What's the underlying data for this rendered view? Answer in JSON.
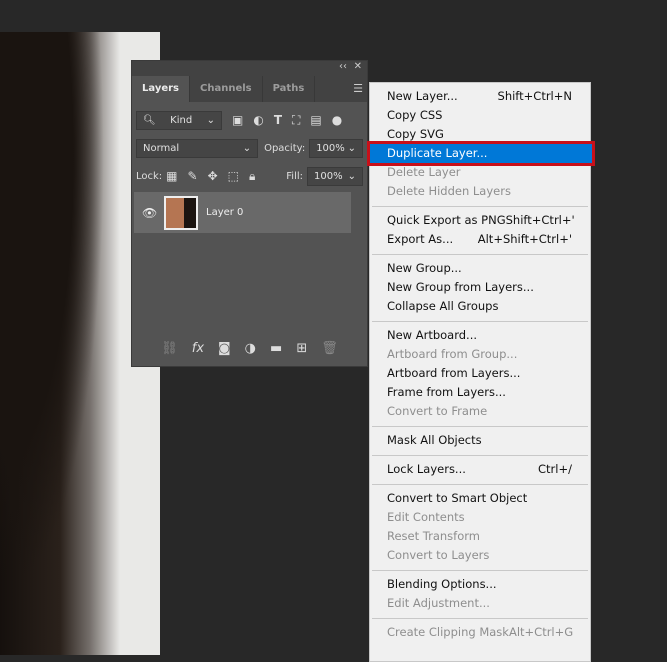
{
  "panel": {
    "tabs": [
      "Layers",
      "Channels",
      "Paths"
    ],
    "filter": "Kind",
    "blend_mode": "Normal",
    "opacity_label": "Opacity:",
    "opacity": "100%",
    "lock_label": "Lock:",
    "fill_label": "Fill:",
    "fill": "100%",
    "layers": [
      {
        "name": "Layer 0",
        "visible": true
      }
    ],
    "collapse": "‹‹",
    "close": "✕"
  },
  "menu": {
    "groups": [
      [
        {
          "label": "New Layer...",
          "shortcut": "Shift+Ctrl+N"
        },
        {
          "label": "Copy CSS"
        },
        {
          "label": "Copy SVG"
        },
        {
          "label": "Duplicate Layer...",
          "selected": true
        },
        {
          "label": "Delete Layer",
          "disabled": true
        },
        {
          "label": "Delete Hidden Layers",
          "disabled": true
        }
      ],
      [
        {
          "label": "Quick Export as PNG",
          "shortcut": "Shift+Ctrl+'"
        },
        {
          "label": "Export As...",
          "shortcut": "Alt+Shift+Ctrl+'"
        }
      ],
      [
        {
          "label": "New Group..."
        },
        {
          "label": "New Group from Layers..."
        },
        {
          "label": "Collapse All Groups"
        }
      ],
      [
        {
          "label": "New Artboard..."
        },
        {
          "label": "Artboard from Group...",
          "disabled": true
        },
        {
          "label": "Artboard from Layers..."
        },
        {
          "label": "Frame from Layers..."
        },
        {
          "label": "Convert to Frame",
          "disabled": true
        }
      ],
      [
        {
          "label": "Mask All Objects"
        }
      ],
      [
        {
          "label": "Lock Layers...",
          "shortcut": "Ctrl+/"
        }
      ],
      [
        {
          "label": "Convert to Smart Object"
        },
        {
          "label": "Edit Contents",
          "disabled": true
        },
        {
          "label": "Reset Transform",
          "disabled": true
        },
        {
          "label": "Convert to Layers",
          "disabled": true
        }
      ],
      [
        {
          "label": "Blending Options..."
        },
        {
          "label": "Edit Adjustment...",
          "disabled": true
        }
      ],
      [
        {
          "label": "Create Clipping Mask",
          "shortcut": "Alt+Ctrl+G",
          "disabled": true
        }
      ]
    ]
  }
}
